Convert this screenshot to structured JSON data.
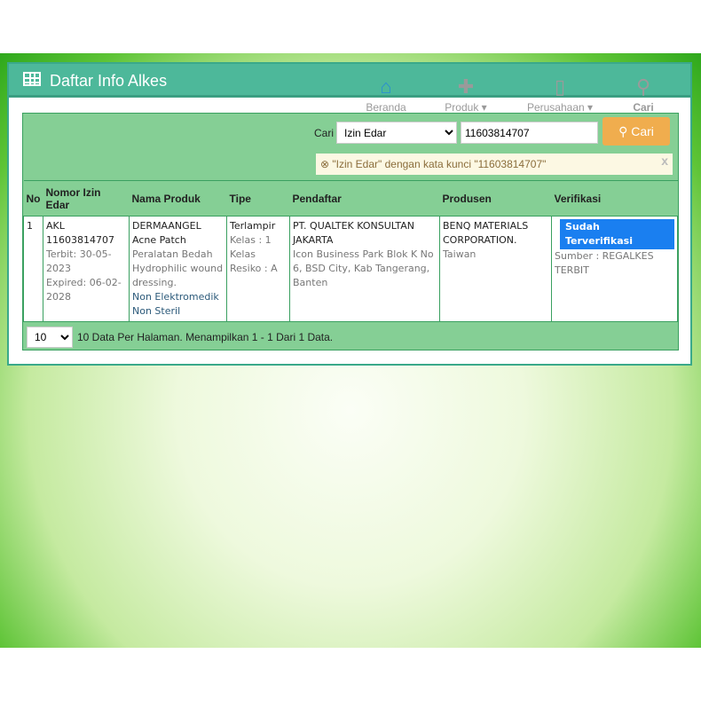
{
  "header": {
    "title": "Daftar Info Alkes"
  },
  "nav": [
    {
      "label": "Beranda",
      "icon": "home-icon"
    },
    {
      "label": "Produk ▾",
      "icon": "medkit-icon"
    },
    {
      "label": "Perusahaan ▾",
      "icon": "building-icon"
    },
    {
      "label": "Cari",
      "icon": "search-icon"
    }
  ],
  "search": {
    "label": "Cari",
    "field": "Izin Edar",
    "value": "11603814707",
    "button": "Cari",
    "alert": "\"Izin Edar\" dengan kata kunci \"11603814707\"",
    "close": "x"
  },
  "table": {
    "headers": [
      "No",
      "Nomor Izin Edar",
      "Nama Produk",
      "Tipe",
      "Pendaftar",
      "Produsen",
      "Verifikasi"
    ],
    "rows": [
      {
        "no": "1",
        "nomor": "AKL 11603814707",
        "terbit": "Terbit: 30-05-2023",
        "expired": "Expired: 06-02-2028",
        "nama": "DERMAANGEL Acne Patch",
        "kategori": "Peralatan Bedah Hydrophilic wound dressing.",
        "elektro": "Non Elektromedik",
        "steril": "Non Steril",
        "tipe": "Terlampir",
        "kelas": "Kelas : 1",
        "resiko": "Kelas Resiko : A",
        "pendaftar": "PT. QUALTEK KONSULTAN JAKARTA",
        "alamat": "Icon Business Park Blok K No 6, BSD City, Kab Tangerang, Banten",
        "produsen": "BENQ MATERIALS CORPORATION.",
        "negara": "Taiwan",
        "verifikasi": "Sudah Terverifikasi",
        "sumber": "Sumber : REGALKES TERBIT"
      }
    ]
  },
  "footer": {
    "per_page": "10",
    "text": "10 Data Per Halaman. Menampilkan 1 - 1 Dari 1 Data."
  }
}
